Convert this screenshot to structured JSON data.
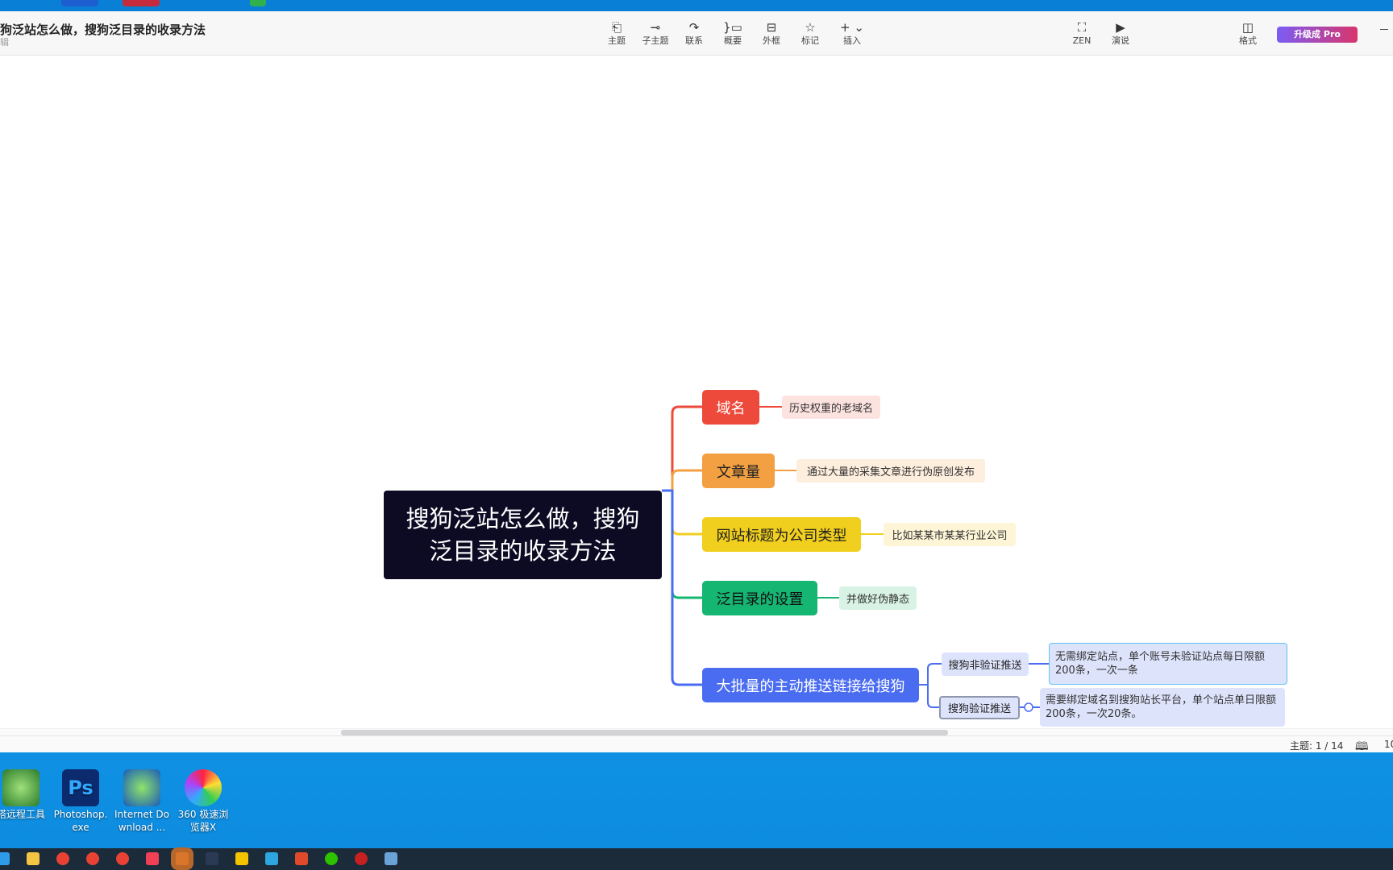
{
  "app": {
    "title": "狗泛站怎么做，搜狗泛目录的收录方法",
    "subtitle": "辑",
    "toolbar": [
      {
        "name": "tool-topic",
        "label": "主题",
        "icon": "topic-icon",
        "glyph": "⎗"
      },
      {
        "name": "tool-subtopic",
        "label": "子主题",
        "icon": "subtopic-icon",
        "glyph": "⊸"
      },
      {
        "name": "tool-relation",
        "label": "联系",
        "icon": "relation-icon",
        "glyph": "↷"
      },
      {
        "name": "tool-summary",
        "label": "概要",
        "icon": "summary-icon",
        "glyph": "}▭"
      },
      {
        "name": "tool-boundary",
        "label": "外框",
        "icon": "boundary-icon",
        "glyph": "⊟"
      },
      {
        "name": "tool-marker",
        "label": "标记",
        "icon": "star-icon",
        "glyph": "☆"
      },
      {
        "name": "tool-insert",
        "label": "插入",
        "icon": "plus-icon",
        "glyph": "+ ⌄"
      },
      {
        "name": "tool-zen",
        "label": "ZEN",
        "icon": "zen-icon",
        "glyph": "⛶"
      },
      {
        "name": "tool-present",
        "label": "演说",
        "icon": "play-icon",
        "glyph": "▶"
      },
      {
        "name": "tool-format",
        "label": "格式",
        "icon": "format-icon",
        "glyph": "◫"
      }
    ],
    "pro_button": "升级成 Pro",
    "status": {
      "topic_count": "主题: 1 / 14",
      "zoom": "10"
    }
  },
  "mindmap": {
    "root": "搜狗泛站怎么做，搜狗泛目录的收录方法",
    "branches": [
      {
        "label": "域名",
        "color": "#ee4a3b",
        "text_color": "#ffffff",
        "detail": "历史权重的老域名",
        "detail_bg": "#fde3e0"
      },
      {
        "label": "文章量",
        "color": "#f3a042",
        "text_color": "#222222",
        "detail": "通过大量的采集文章进行伪原创发布",
        "detail_bg": "#fdeedd"
      },
      {
        "label": "网站标题为公司类型",
        "color": "#f1cf1e",
        "text_color": "#222222",
        "detail": "比如某某市某某行业公司",
        "detail_bg": "#fdf5d6"
      },
      {
        "label": "泛目录的设置",
        "color": "#15b572",
        "text_color": "#111111",
        "detail": "并做好伪静态",
        "detail_bg": "#d8f2e5"
      },
      {
        "label": "大批量的主动推送链接给搜狗",
        "color": "#4a6cf0",
        "text_color": "#ffffff",
        "children": [
          {
            "label": "搜狗非验证推送",
            "detail": "无需绑定站点，单个账号未验证站点每日限额200条，一次一条"
          },
          {
            "label": "搜狗验证推送",
            "detail": "需要绑定域名到搜狗站长平台，单个站点单日限额200条，一次20条。"
          }
        ]
      }
    ]
  },
  "desktop_icons": [
    {
      "label": "塔远程工具",
      "icon": "remote-tool-icon"
    },
    {
      "label": "Photoshop.exe",
      "icon": "photoshop-icon"
    },
    {
      "label": "Internet Download ...",
      "icon": "idm-icon"
    },
    {
      "label": "360 极速浏览器X",
      "icon": "browser-360-icon"
    }
  ],
  "taskbar_icons": [
    "start-icon",
    "explorer-icon",
    "chrome-icon",
    "chrome-icon",
    "chrome-icon",
    "pocket-icon",
    "app-icon",
    "terminal-icon",
    "mail-icon",
    "telegram-icon",
    "wps-icon",
    "wechat-icon",
    "record-icon",
    "notes-icon"
  ]
}
